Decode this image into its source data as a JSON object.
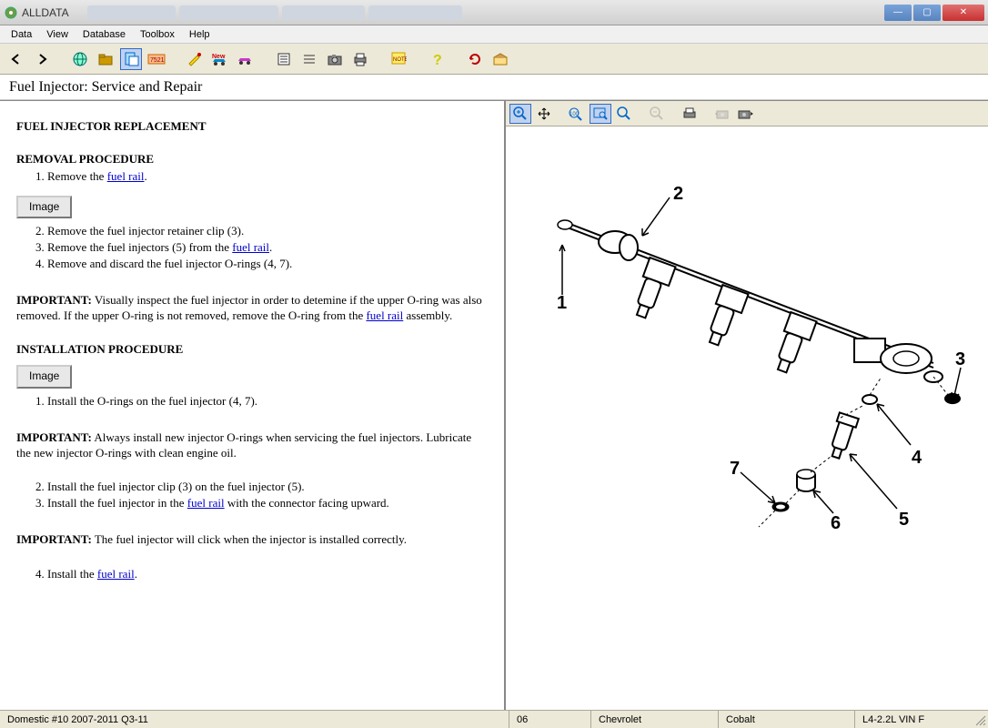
{
  "window": {
    "title": "ALLDATA",
    "controls": {
      "min": "—",
      "max": "▢",
      "close": "✕"
    }
  },
  "menu": {
    "items": [
      "Data",
      "View",
      "Database",
      "Toolbox",
      "Help"
    ]
  },
  "page": {
    "title": "Fuel Injector:  Service and Repair"
  },
  "doc": {
    "h1": "FUEL INJECTOR REPLACEMENT",
    "removal_heading": "REMOVAL PROCEDURE",
    "removal_1a": "Remove the ",
    "fuel_rail": "fuel rail",
    "image_btn": "Image",
    "removal_2": "Remove the fuel injector retainer clip (3).",
    "removal_3a": "Remove the fuel injectors (5) from the ",
    "removal_4": "Remove and discard the fuel injector O-rings (4, 7).",
    "important_label": "IMPORTANT:",
    "important_1a": "  Visually inspect the fuel injector in order to detemine if the upper O-ring was also removed. If the upper O-ring is not removed, remove the O-ring from the ",
    "important_1b": " assembly.",
    "install_heading": "INSTALLATION PROCEDURE",
    "install_1": "Install the O-rings on the fuel injector (4, 7).",
    "important_2": "  Always install new injector O-rings when servicing the fuel injectors. Lubricate the new injector O-rings with clean engine oil.",
    "install_2": "Install the fuel injector clip (3) on the fuel injector (5).",
    "install_3a": "Install the fuel injector in the ",
    "install_3b": " with the connector facing upward.",
    "important_3": "  The fuel injector will click when the injector is installed correctly.",
    "install_4a": "Install the "
  },
  "status": {
    "disc": "Domestic #10 2007-2011 Q3-11",
    "year": "06",
    "make": "Chevrolet",
    "model": "Cobalt",
    "engine": "L4-2.2L VIN F"
  }
}
